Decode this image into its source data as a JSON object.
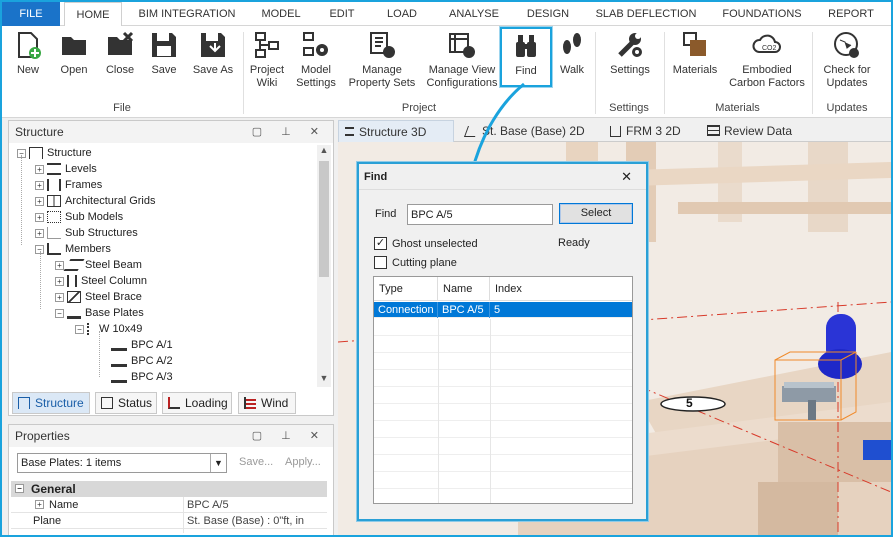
{
  "tabs": [
    "FILE",
    "HOME",
    "BIM INTEGRATION",
    "MODEL",
    "EDIT",
    "LOAD",
    "ANALYSE",
    "DESIGN",
    "SLAB DEFLECTION",
    "FOUNDATIONS",
    "REPORT"
  ],
  "ribbon": {
    "new": "New",
    "open": "Open",
    "close": "Close",
    "save": "Save",
    "save_as": "Save As",
    "project_wiki_1": "Project",
    "project_wiki_2": "Wiki",
    "model_settings_1": "Model",
    "model_settings_2": "Settings",
    "manage_property_1": "Manage",
    "manage_property_2": "Property Sets",
    "manage_view_1": "Manage View",
    "manage_view_2": "Configurations",
    "find": "Find",
    "walk": "Walk",
    "settings": "Settings",
    "materials": "Materials",
    "embodied_1": "Embodied",
    "embodied_2": "Carbon Factors",
    "updates_1": "Check for",
    "updates_2": "Updates",
    "group_file": "File",
    "group_project": "Project",
    "group_settings": "Settings",
    "group_materials": "Materials",
    "group_updates": "Updates"
  },
  "structure_panel": {
    "title": "Structure",
    "tree": [
      "Structure",
      "Levels",
      "Frames",
      "Architectural Grids",
      "Sub Models",
      "Sub Structures",
      "Members",
      "Steel Beam",
      "Steel Column",
      "Steel Brace",
      "Base Plates",
      "W 10x49",
      "BPC A/1",
      "BPC A/2",
      "BPC A/3"
    ]
  },
  "bottom_tabs": [
    "Structure",
    "Status",
    "Loading",
    "Wind"
  ],
  "properties_panel": {
    "title": "Properties",
    "selector": "Base Plates: 1 items",
    "save": "Save...",
    "apply": "Apply...",
    "section": "General",
    "rows": [
      {
        "name": "Name",
        "value": "BPC A/5"
      },
      {
        "name": "Plane",
        "value": "St. Base (Base) : 0\"ft, in"
      }
    ]
  },
  "doc_tabs": [
    "Structure 3D",
    "St. Base (Base) 2D",
    "FRM 3 2D",
    "Review Data"
  ],
  "find_dialog": {
    "title": "Find",
    "find_label": "Find",
    "find_value": "BPC A/5",
    "select": "Select",
    "status": "Ready",
    "ghost": "Ghost unselected",
    "cutting": "Cutting plane",
    "columns": [
      "Type",
      "Name",
      "Index"
    ],
    "rows": [
      {
        "type": "Connection",
        "name": "BPC A/5",
        "index": "5"
      }
    ]
  },
  "viewport": {
    "grid_label": "5"
  },
  "colors": {
    "accent": "#1aa3dd",
    "file_tab": "#1a73c9",
    "selection": "#0078d7"
  }
}
